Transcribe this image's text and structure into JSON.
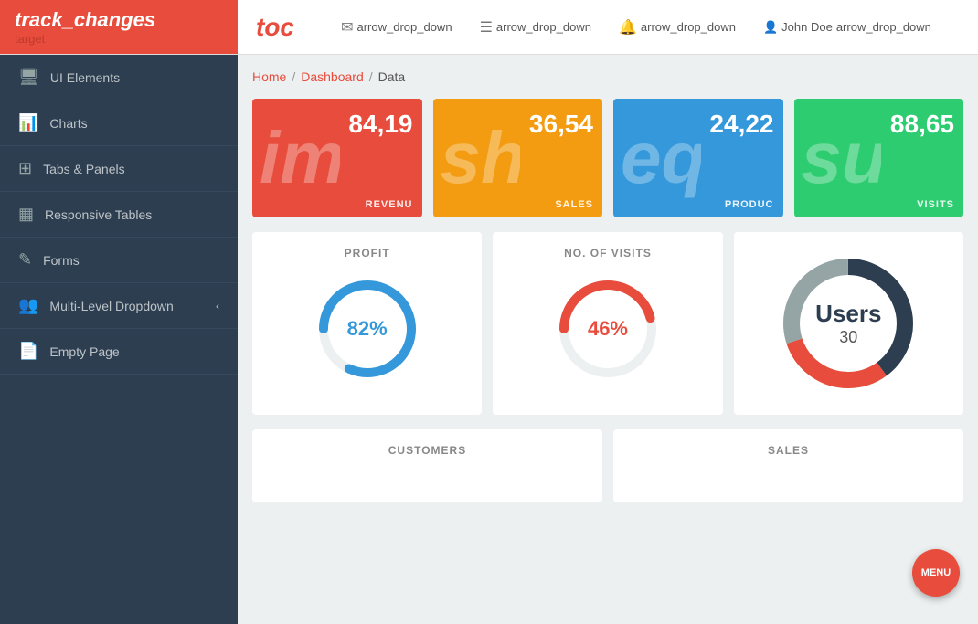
{
  "header": {
    "logo_text": "track_changes",
    "logo_subtitle": "target",
    "toc_label": "toc",
    "nav_items": [
      {
        "icon": "✉",
        "label": "arrow_drop_down"
      },
      {
        "icon": "≡",
        "label": "arrow_drop_down"
      },
      {
        "icon": "🔔",
        "label": "arrow_drop_down"
      },
      {
        "icon": "👤",
        "label": "John Doe",
        "extra": "arrow_drop_down"
      }
    ]
  },
  "breadcrumb": {
    "home": "Home",
    "sep1": "/",
    "dashboard": "Dashboard",
    "sep2": "/",
    "current": "Data"
  },
  "stat_cards": [
    {
      "bg_text": "imp",
      "number": "84,19",
      "label": "REVENU",
      "color": "card-red"
    },
    {
      "bg_text": "sho",
      "number": "36,54",
      "label": "SALES",
      "color": "card-orange"
    },
    {
      "bg_text": "equ",
      "number": "24,22",
      "label": "PRODUC",
      "color": "card-blue"
    },
    {
      "bg_text": "sup",
      "number": "88,65",
      "label": "VISITS",
      "color": "card-green"
    }
  ],
  "donut_cards": [
    {
      "title": "PROFIT",
      "value": "82%",
      "color_class": "blue",
      "stroke_color": "#3498db",
      "bg_color": "#ecf0f1",
      "pct": 82
    },
    {
      "title": "NO. OF VISITS",
      "value": "46%",
      "color_class": "red",
      "stroke_color": "#e74c3c",
      "bg_color": "#ecf0f1",
      "pct": 46
    }
  ],
  "users_donut": {
    "title": "Users",
    "count": "30",
    "segments": [
      {
        "color": "#2c3e50",
        "pct": 40
      },
      {
        "color": "#e74c3c",
        "pct": 30
      },
      {
        "color": "#95a5a6",
        "pct": 30
      }
    ]
  },
  "bottom_cards": [
    {
      "title": "CUSTOMERS"
    },
    {
      "title": "SALES"
    }
  ],
  "sidebar": {
    "items": [
      {
        "icon": "🖥",
        "label": "UI Elements"
      },
      {
        "icon": "📊",
        "label": "Charts"
      },
      {
        "icon": "⊞",
        "label": "Tabs & Panels"
      },
      {
        "icon": "▦",
        "label": "Responsive Tables"
      },
      {
        "icon": "✎",
        "label": "Forms"
      },
      {
        "icon": "👥",
        "label": "Multi-Level Dropdown",
        "has_expand": true
      },
      {
        "icon": "📄",
        "label": "Empty Page"
      }
    ]
  },
  "menu_fab_label": "MENU"
}
